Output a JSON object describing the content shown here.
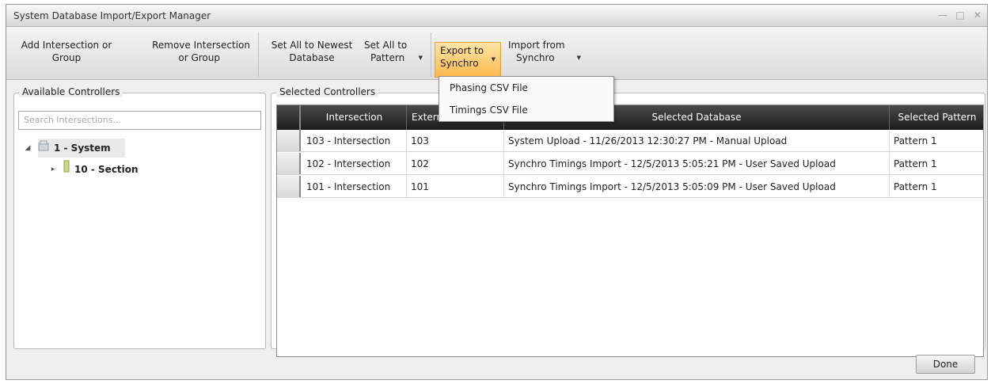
{
  "window": {
    "title": "System Database Import/Export Manager"
  },
  "toolbar": {
    "add_group_line1": "Add Intersection or",
    "add_group_line2": "Group",
    "remove_group_line1": "Remove Intersection",
    "remove_group_line2": "or Group",
    "set_newest_line1": "Set All to Newest",
    "set_newest_line2": "Database",
    "set_pattern_line1": "Set All to",
    "set_pattern_line2": "Pattern",
    "export_line1": "Export to",
    "export_line2": "Synchro",
    "import_line1": "Import from",
    "import_line2": "Synchro"
  },
  "export_menu": {
    "items": [
      "Phasing CSV File",
      "Timings CSV File"
    ]
  },
  "available": {
    "label": "Available Controllers",
    "search_placeholder": "Search Intersections...",
    "tree": [
      {
        "label": "1 - System",
        "icon": "system-icon",
        "expanded": true
      },
      {
        "label": "10 - Section",
        "icon": "section-icon",
        "expanded": false
      }
    ]
  },
  "selected": {
    "label": "Selected Controllers",
    "columns": [
      "Intersection",
      "External",
      "Selected Database",
      "Selected Pattern"
    ],
    "rows": [
      [
        "103 - Intersection",
        "103",
        "System Upload - 11/26/2013 12:30:27 PM - Manual Upload",
        "Pattern 1"
      ],
      [
        "102 - Intersection",
        "102",
        "Synchro Timings Import - 12/5/2013 5:05:21 PM - User Saved Upload",
        "Pattern 1"
      ],
      [
        "101 - Intersection",
        "101",
        "Synchro Timings Import - 12/5/2013 5:05:09 PM - User Saved Upload",
        "Pattern 1"
      ]
    ]
  },
  "footer": {
    "done_label": "Done"
  },
  "colors": {
    "header_dark": "#1b1b1b",
    "active_orange": "#ffb84d",
    "window_bg": "#efefef"
  }
}
